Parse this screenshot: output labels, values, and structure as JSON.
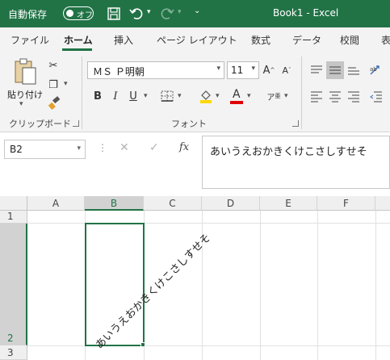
{
  "titlebar": {
    "autosave_label": "自動保存",
    "autosave_state": "オフ",
    "title": "Book1  -  Excel"
  },
  "tabs": [
    "ファイル",
    "ホーム",
    "挿入",
    "ページ レイアウト",
    "数式",
    "データ",
    "校閲",
    "表"
  ],
  "ribbon": {
    "paste_label": "貼り付け",
    "clipboard_group": "クリップボード",
    "font_name": "ＭＳ Ｐ明朝",
    "font_size": "11",
    "font_group": "フォント",
    "bold": "B",
    "italic": "I",
    "underline": "U",
    "font_color_letter": "A",
    "highlight_color": "#ffd800",
    "font_color": "#e00000"
  },
  "formula_bar": {
    "name_box": "B2",
    "fx": "fx",
    "content": "あいうえおかきくけこさしすせそ"
  },
  "grid": {
    "columns": [
      "A",
      "B",
      "C",
      "D",
      "E",
      "F"
    ],
    "rows": [
      "1",
      "2",
      "3"
    ],
    "selected_cell": "B2",
    "cell_b2_text": "あいうえおかきくけこさしすせそ"
  },
  "colors": {
    "brand": "#217346"
  }
}
